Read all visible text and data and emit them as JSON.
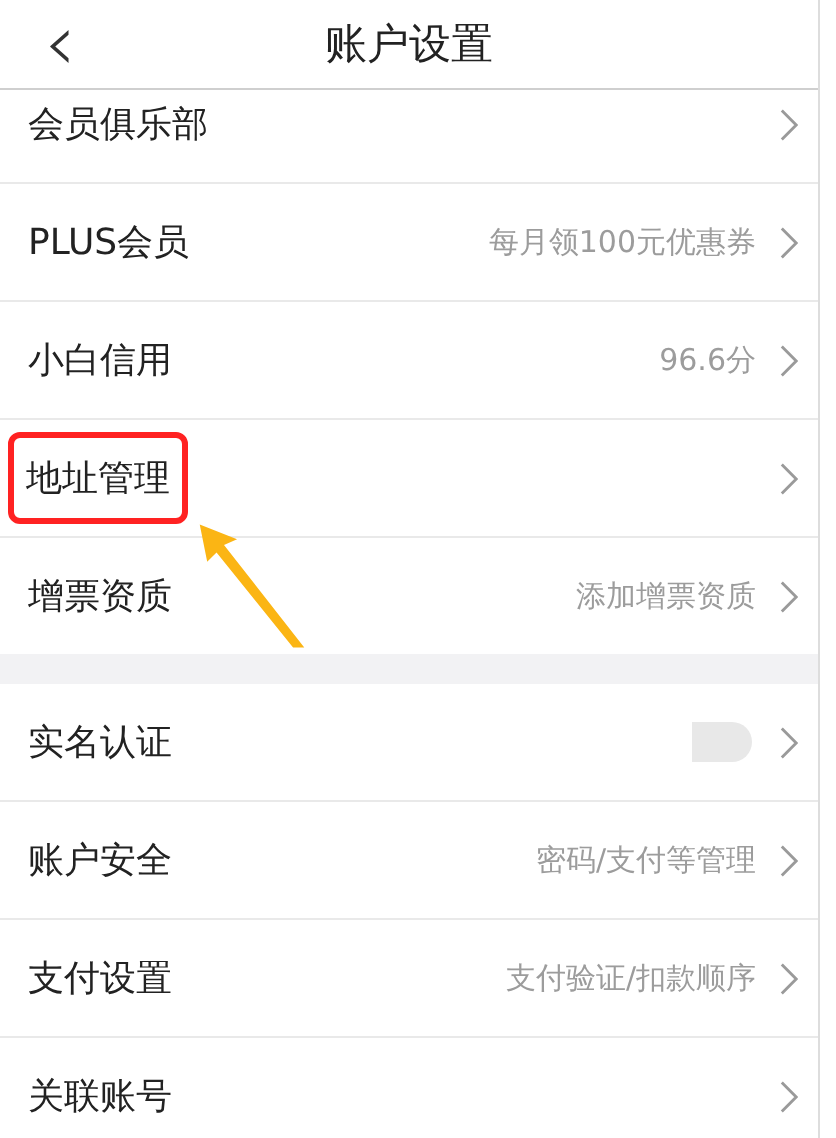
{
  "header": {
    "back": "‹",
    "title": "账户设置"
  },
  "groups": [
    {
      "items": [
        {
          "label": "会员俱乐部",
          "highlighted": false,
          "redacted": false
        },
        {
          "label": "PLUS会员",
          "value": "每月领100元优惠券",
          "highlighted": false,
          "redacted": false
        },
        {
          "label": "小白信用",
          "value": "96.6分",
          "highlighted": false,
          "redacted": false
        },
        {
          "label": "地址管理",
          "highlighted": true,
          "redacted": false
        },
        {
          "label": "增票资质",
          "value": "添加增票资质",
          "highlighted": false,
          "redacted": false
        }
      ]
    },
    {
      "items": [
        {
          "label": "实名认证",
          "highlighted": false,
          "redacted": true
        },
        {
          "label": "账户安全",
          "value": "密码/支付等管理",
          "highlighted": false,
          "redacted": false
        },
        {
          "label": "支付设置",
          "value": "支付验证/扣款顺序",
          "highlighted": false,
          "redacted": false
        },
        {
          "label": "关联账号",
          "highlighted": false,
          "redacted": false
        }
      ]
    }
  ]
}
